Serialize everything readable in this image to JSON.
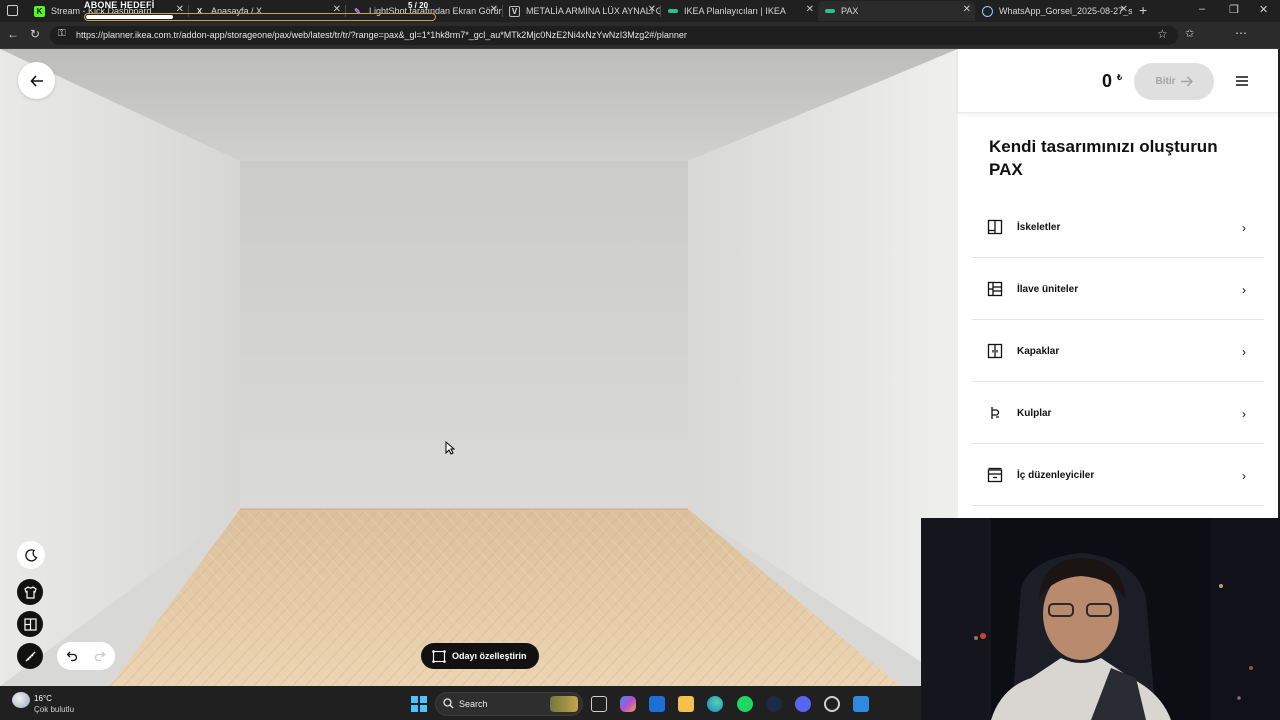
{
  "browser": {
    "tabs": [
      {
        "label": "Stream - Kick Dashboard",
        "fav": "K",
        "fav_color": "#53fc18"
      },
      {
        "label": "Anasayfa / X",
        "fav": "X",
        "fav_color": "#e0e0e0"
      },
      {
        "label": "LightShot tarafından Ekran Görün",
        "fav": "",
        "fav_color": "#b47be6"
      },
      {
        "label": "METALİA ARMİNA LÜX AYNALI G",
        "fav": "V",
        "fav_color": "#e0e0e0"
      },
      {
        "label": "IKEA Planlayıcıları | IKEA",
        "fav": "",
        "fav_color": "#2fbf8c"
      },
      {
        "label": "PAX",
        "fav": "",
        "fav_color": "#2fbf8c"
      },
      {
        "label": "WhatsApp_Gorsel_2025-08-27_s",
        "fav": "",
        "fav_color": "#9ec7ff"
      }
    ],
    "url": "https://planner.ikea.com.tr/addon-app/storageone/pax/web/latest/tr/tr/?range=pax&_gl=1*1hk8rm7*_gcl_au*MTk2Mjc0NzE2Ni4xNzYwNzI3Mzg2#/planner"
  },
  "stream_overlay": {
    "goal_label": "ABONE HEDEFİ",
    "goal_count": "5 / 20",
    "goal_fraction": 0.25
  },
  "planner": {
    "price": "0",
    "currency": "₺",
    "finish_label": "Bitir",
    "title": "Kendi tasarımınızı oluşturun PAX",
    "categories": [
      {
        "label": "İskeletler",
        "icon": "frame-icon"
      },
      {
        "label": "İlave üniteler",
        "icon": "add-units-icon"
      },
      {
        "label": "Kapaklar",
        "icon": "doors-icon"
      },
      {
        "label": "Kulplar",
        "icon": "handle-icon"
      },
      {
        "label": "İç düzenleyiciler",
        "icon": "organizer-icon"
      }
    ],
    "customize_room_label": "Odayı özelleştirin",
    "colors": {
      "floor": "#e6cba7",
      "wall": "#dcdcda",
      "dark_button": "#111111"
    }
  },
  "taskbar": {
    "temperature": "16°C",
    "weather": "Çok bulutlu",
    "search_label": "Search"
  }
}
